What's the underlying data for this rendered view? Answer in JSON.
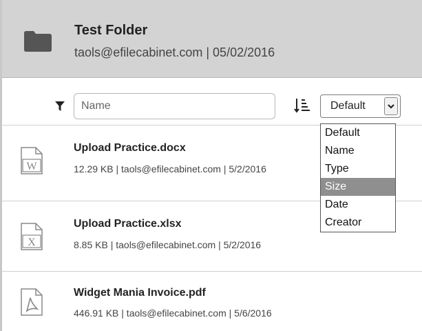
{
  "folder": {
    "title": "Test Folder",
    "subtitle": "taols@efilecabinet.com | 05/02/2016",
    "icon": "folder-icon"
  },
  "toolbar": {
    "filter_icon": "filter-icon",
    "name_placeholder": "Name",
    "name_value": "",
    "sort_icon": "sort-order-icon",
    "sort_selected": "Default"
  },
  "sort_options": [
    {
      "label": "Default",
      "selected": false
    },
    {
      "label": "Name",
      "selected": false
    },
    {
      "label": "Type",
      "selected": false
    },
    {
      "label": "Size",
      "selected": true
    },
    {
      "label": "Date",
      "selected": false
    },
    {
      "label": "Creator",
      "selected": false
    }
  ],
  "files": [
    {
      "name": "Upload Practice.docx",
      "meta": "12.29 KB | taols@efilecabinet.com | 5/2/2016",
      "icon": "word-document-icon",
      "badge": "W"
    },
    {
      "name": "Upload Practice.xlsx",
      "meta": "8.85 KB | taols@efilecabinet.com | 5/2/2016",
      "icon": "excel-document-icon",
      "badge": "X"
    },
    {
      "name": "Widget Mania Invoice.pdf",
      "meta": "446.91 KB | taols@efilecabinet.com | 5/6/2016",
      "icon": "pdf-document-icon",
      "badge": ""
    }
  ],
  "colors": {
    "header_bg": "#d3d3d3",
    "selected_option_bg": "#8f8f8f",
    "icon_gray": "#6b6b6b"
  }
}
